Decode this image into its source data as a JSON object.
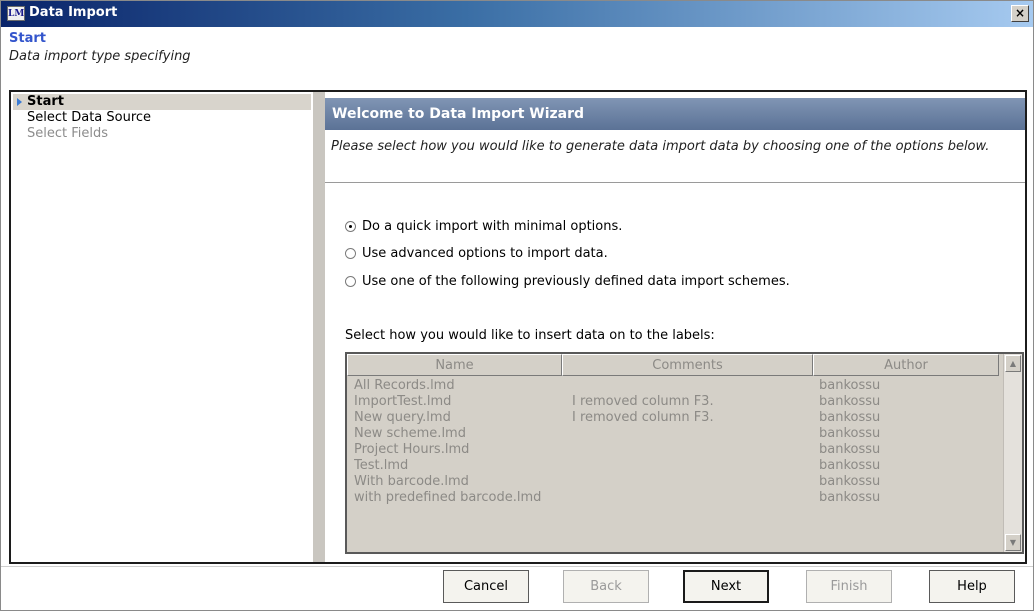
{
  "window": {
    "title": "Data Import",
    "app_icon_text": "LM",
    "close_glyph": "×"
  },
  "header": {
    "title": "Start",
    "subtitle": "Data import type specifying"
  },
  "nav": {
    "items": [
      {
        "label": "Start",
        "state": "active"
      },
      {
        "label": "Select Data Source",
        "state": "normal"
      },
      {
        "label": "Select Fields",
        "state": "disabled"
      }
    ]
  },
  "content": {
    "banner": "Welcome to Data Import Wizard",
    "intro": "Please select how you would like to generate data import data by choosing one of the options below.",
    "options": [
      {
        "label": "Do a quick import with minimal options.",
        "checked": true
      },
      {
        "label": "Use advanced options to import data.",
        "checked": false
      },
      {
        "label": "Use one of the following previously defined data import schemes.",
        "checked": false
      }
    ],
    "table_label": "Select how you would like to insert data on to the labels:",
    "table": {
      "columns": [
        "Name",
        "Comments",
        "Author"
      ],
      "rows": [
        [
          "All Records.lmd",
          "",
          "bankossu"
        ],
        [
          "ImportTest.lmd",
          "I removed column F3.",
          "bankossu"
        ],
        [
          "New query.lmd",
          "I removed column F3.",
          "bankossu"
        ],
        [
          "New scheme.lmd",
          "",
          "bankossu"
        ],
        [
          "Project Hours.lmd",
          "",
          "bankossu"
        ],
        [
          "Test.lmd",
          "",
          "bankossu"
        ],
        [
          "With barcode.lmd",
          "",
          "bankossu"
        ],
        [
          "with predefined barcode.lmd",
          "",
          "bankossu"
        ]
      ]
    }
  },
  "buttons": {
    "cancel": "Cancel",
    "back": "Back",
    "next": "Next",
    "finish": "Finish",
    "help": "Help"
  },
  "icons": {
    "nav_arrow": "triangle-right-icon",
    "scroll_up": "scroll-up-icon",
    "scroll_down": "scroll-down-icon"
  }
}
